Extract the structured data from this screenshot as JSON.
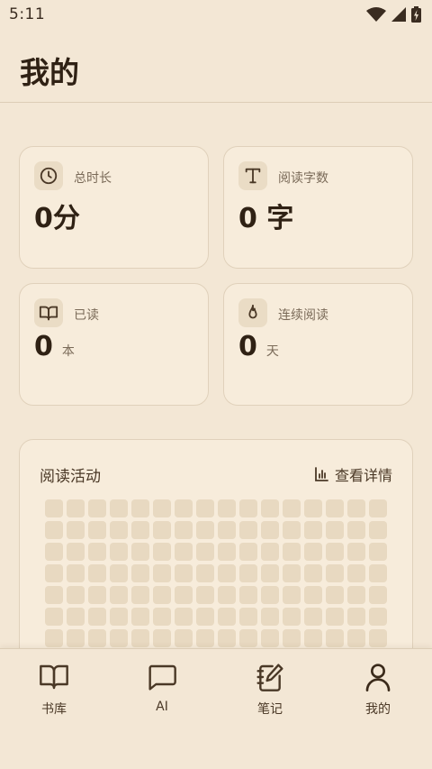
{
  "status_bar": {
    "time": "5:11"
  },
  "header": {
    "title": "我的"
  },
  "stats": [
    {
      "id": "total-time",
      "icon": "clock-icon",
      "label": "总时长",
      "value": "0分",
      "unit": ""
    },
    {
      "id": "words-read",
      "icon": "text-icon",
      "label": "阅读字数",
      "value": "0 字",
      "unit": ""
    },
    {
      "id": "books-read",
      "icon": "book-open-icon",
      "label": "已读",
      "value": "0",
      "unit": "本"
    },
    {
      "id": "streak",
      "icon": "flame-icon",
      "label": "连续阅读",
      "value": "0",
      "unit": "天"
    }
  ],
  "activity": {
    "title": "阅读活动",
    "details_label": "查看详情",
    "grid": {
      "columns": 16,
      "visible_rows": 7,
      "level_colors": [
        "#e8d9c1"
      ]
    }
  },
  "nav": {
    "items": [
      {
        "id": "library",
        "label": "书库",
        "icon": "book-open-icon"
      },
      {
        "id": "ai",
        "label": "AI",
        "icon": "chat-bubble-icon"
      },
      {
        "id": "notes",
        "label": "笔记",
        "icon": "notebook-pen-icon"
      },
      {
        "id": "me",
        "label": "我的",
        "icon": "user-icon",
        "active": true
      }
    ]
  },
  "colors": {
    "background": "#f3e7d5",
    "card": "#f7ecdb",
    "text_primary": "#2f2114",
    "text_secondary": "#7a6a58"
  }
}
